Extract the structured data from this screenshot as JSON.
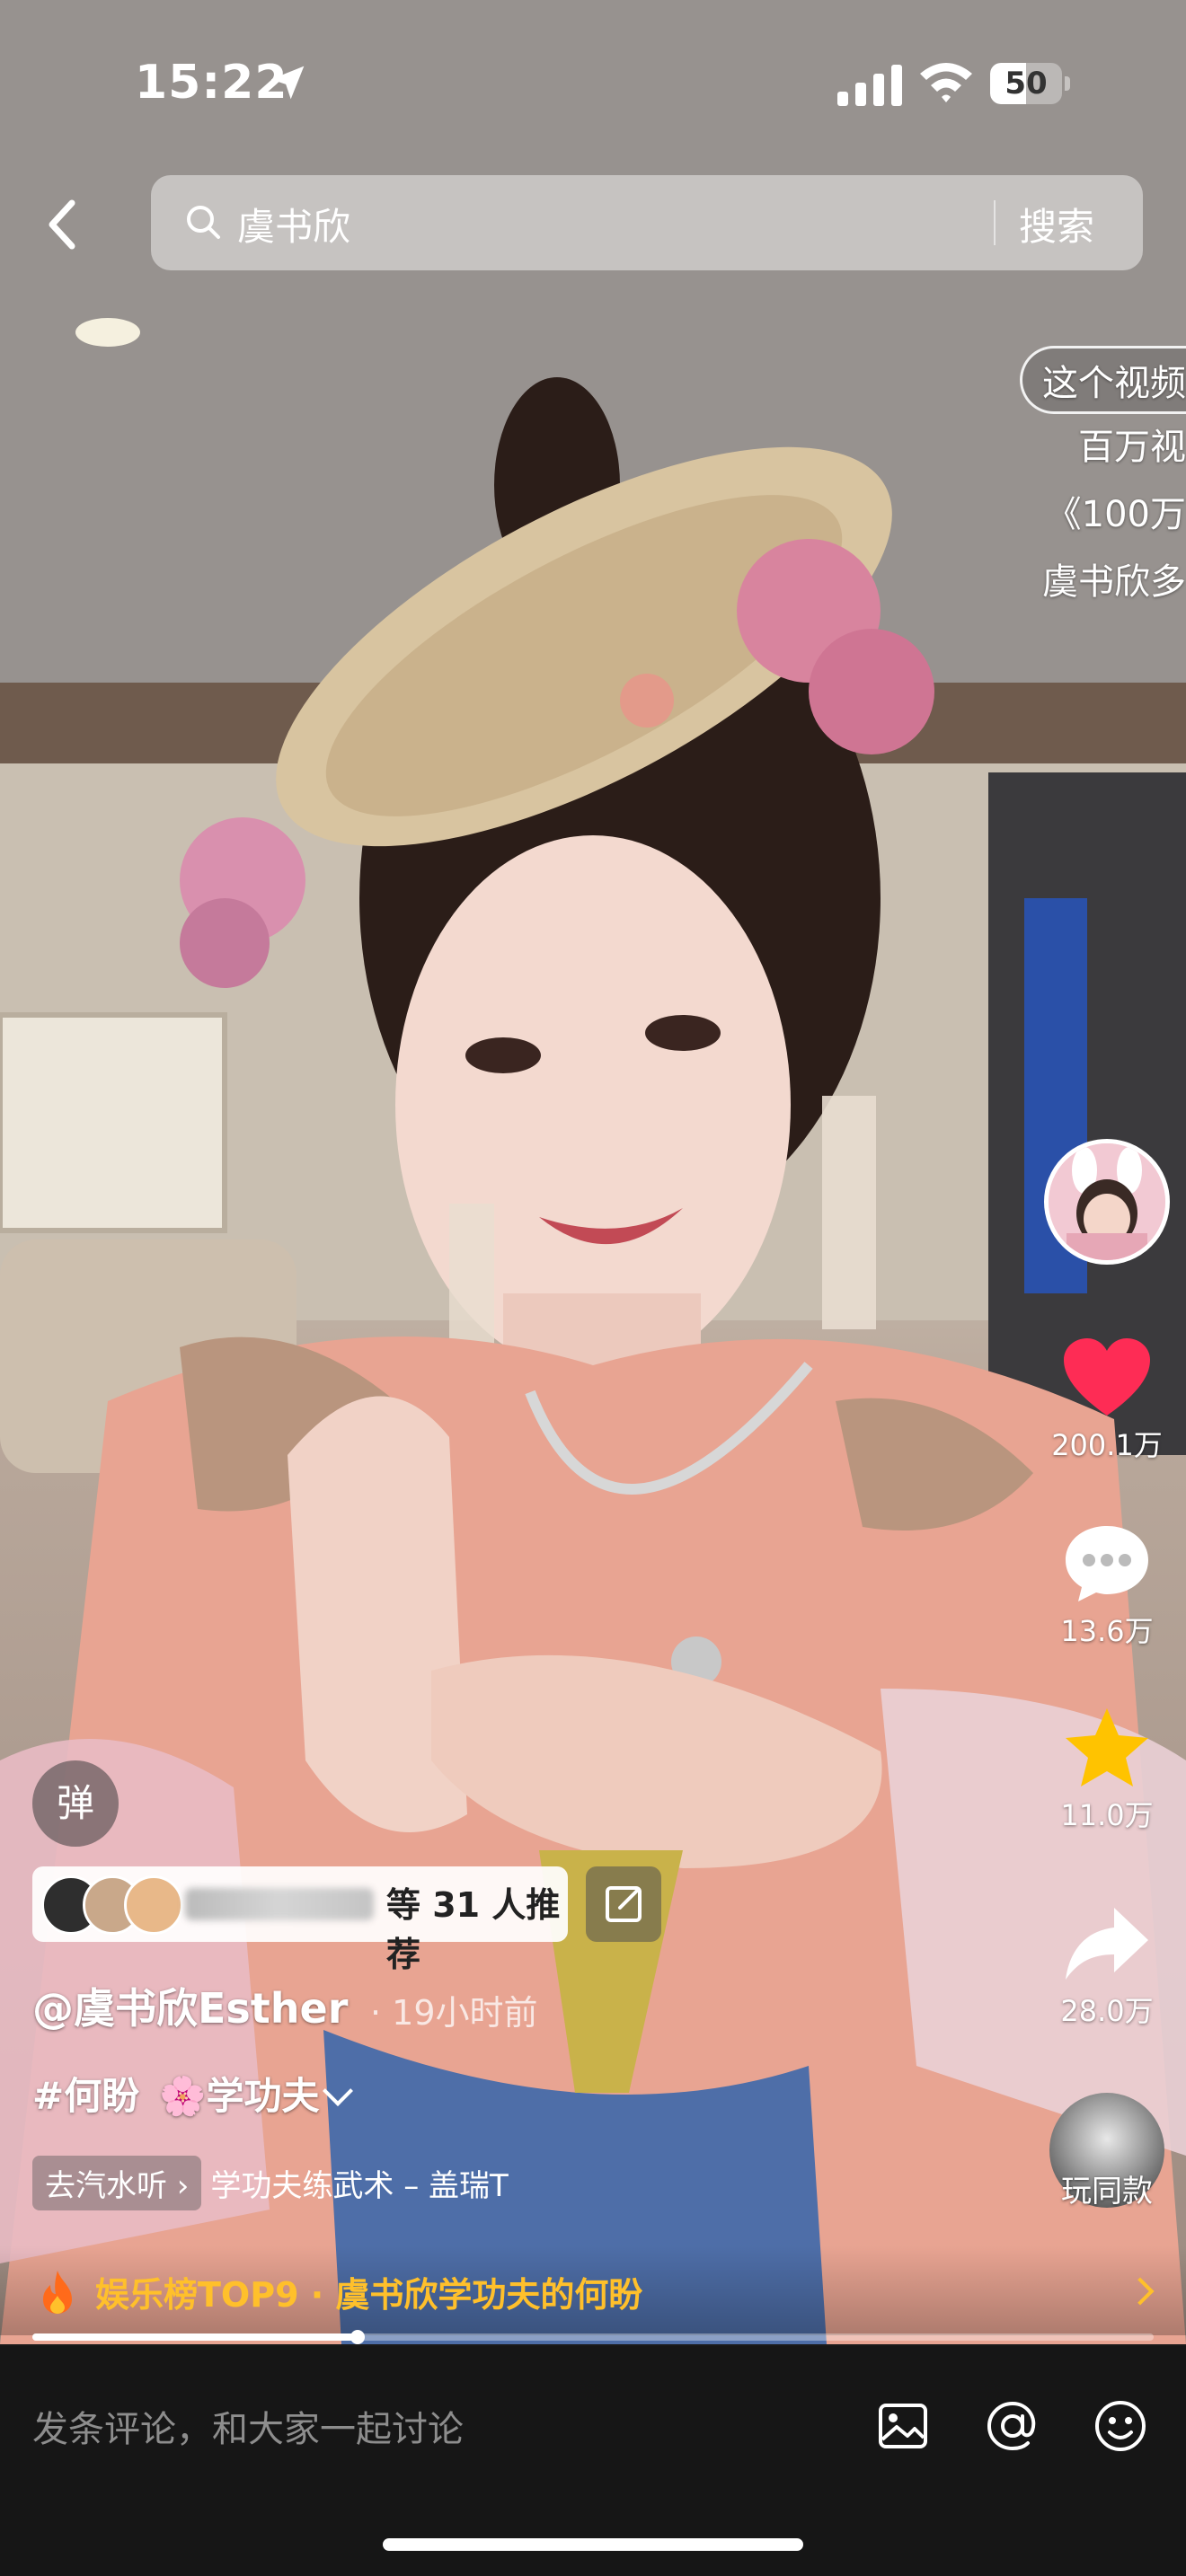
{
  "status_bar": {
    "time": "15:22",
    "battery": "50",
    "battery_level": 0.5
  },
  "search": {
    "query": "虞书欣",
    "button_label": "搜索"
  },
  "promo_overlay": {
    "lines": [
      "这个视频",
      "百万视",
      "《100万",
      "虞书欣多"
    ]
  },
  "actions": {
    "likes": "200.1万",
    "comments": "13.6万",
    "favorites": "11.0万",
    "shares": "28.0万",
    "remix_label": "玩同款"
  },
  "danmu": {
    "label": "弹"
  },
  "recommend": {
    "text": "等 31 人推荐"
  },
  "post": {
    "author": "@虞书欣Esther",
    "time": "· 19小时前",
    "tag1": "#何盼",
    "tag2": "🌸学功夫",
    "music_chip": "去汽水听 ›",
    "music_title": "学功夫练武术 – 盖瑞T"
  },
  "hot": {
    "text": "娱乐榜TOP9 · 虞书欣学功夫的何盼"
  },
  "playback": {
    "progress": 0.29
  },
  "comment_bar": {
    "placeholder": "发条评论，和大家一起讨论"
  },
  "colors": {
    "like": "#fe2c55",
    "favorite": "#ffc300",
    "hot_text": "#ffc02b"
  },
  "icons": [
    "location-arrow-icon",
    "cellular-signal-icon",
    "wifi-icon",
    "back-chevron-icon",
    "search-icon",
    "heart-icon",
    "comment-bubble-icon",
    "star-icon",
    "share-arrow-icon",
    "fire-icon",
    "edit-icon",
    "image-icon",
    "at-icon",
    "emoji-icon"
  ]
}
